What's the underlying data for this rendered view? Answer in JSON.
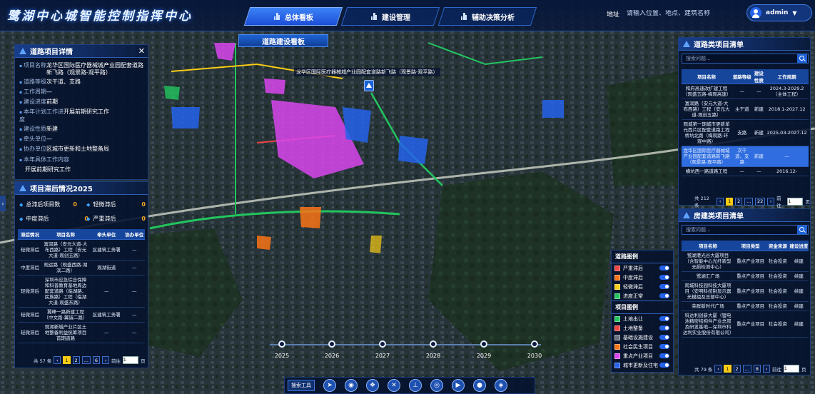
{
  "app": {
    "title": "鹭湖中心城智能控制指挥中心"
  },
  "nav": {
    "tabs": [
      {
        "label": "总体看板",
        "active": true
      },
      {
        "label": "建设管理",
        "active": false
      },
      {
        "label": "辅助决策分析",
        "active": false
      }
    ]
  },
  "search": {
    "label": "地址",
    "placeholder": "请输入位置、地点、建筑名称"
  },
  "user": {
    "name": "admin"
  },
  "board": {
    "title": "道路建设看板"
  },
  "map": {
    "label": "龙华区国际医疗器械城产业园配套道路新飞路（观景路-观平路）",
    "icon": "project-pin-icon"
  },
  "detail": {
    "title": "道路项目详情",
    "rows": [
      {
        "k": "项目名称",
        "v": "龙华区国际医疗器械城产业园配套道路新飞路（观景路-观平路）"
      },
      {
        "k": "道路等级",
        "v": "次干道、支路"
      },
      {
        "k": "工作周期",
        "v": "—"
      },
      {
        "k": "建设进度",
        "v": "前期"
      },
      {
        "k": "本年计划工作进度",
        "v": "开展前期研究工作"
      },
      {
        "k": "建设性质",
        "v": "新建"
      },
      {
        "k": "牵头单位",
        "v": "—"
      },
      {
        "k": "协办单位",
        "v": "区城市更新和土地整备局"
      }
    ],
    "content_label": "本年具体工作内容",
    "content_value": "开展前期研究工作"
  },
  "lag": {
    "title": "项目滞后情况2025",
    "stats": [
      {
        "label": "总滞后项目数",
        "value": "0"
      },
      {
        "label": "轻微滞后",
        "value": "0"
      },
      {
        "label": "中度滞后",
        "value": "0"
      },
      {
        "label": "严重滞后",
        "value": "0"
      }
    ],
    "headers": [
      "滞后情况",
      "项目名称",
      "牵头单位",
      "协办单位"
    ],
    "rows": [
      [
        "轻微滞后",
        "富润路（安元大道-大布西路）工程（安元大道-观创五路）",
        "区建筑工务署",
        "—"
      ],
      [
        "中度滞后",
        "观运路（观盛西路-湖滨二路）",
        "观湖街道",
        "—"
      ],
      [
        "轻微滞后",
        "深圳市应急综合保障和科普教育基地周边配套道路（临湖路、民族路）工程（临湖大道-观盛东路）",
        "—",
        "—"
      ],
      [
        "轻微滞后",
        "翼峰一路新建工程（中文路-翼诚二路）",
        "区建筑工务署",
        "—"
      ],
      [
        "轻微滞后",
        "观湖新城产业片区土地整备利益统筹项目首期道路",
        "—",
        "—"
      ]
    ],
    "pager": {
      "total": "共 57 条",
      "pages": [
        "1",
        "2",
        "...",
        "6"
      ],
      "current": "1",
      "goto_label": "前往",
      "goto_value": "1",
      "unit": "页"
    }
  },
  "road_list": {
    "title": "道路类项目清单",
    "search_placeholder": "搜索问题...",
    "headers": [
      "项目名称",
      "道路等级",
      "建设性质",
      "工作周期"
    ],
    "rows": [
      [
        "和府高速改扩建工程（观盛五路-梅观高速）",
        "—",
        "—",
        "2024.3-2029.2（主体工程）"
      ],
      [
        "富润路（安元大道-大布西路）工程（安元大道-观创五路）",
        "主干道",
        "新建",
        "2018.1-2027.12"
      ],
      [
        "观城第一期城市更新单元西片区配套道路工程桥坑北路（梅观路-环观中路）",
        "支路",
        "新建",
        "2025.03-2027.12"
      ],
      [
        "龙华区国际医疗器械城产业园配套道路新飞路（观景路-观平路）",
        "次干道、支路",
        "新建",
        "—"
      ],
      [
        "横坑西一路道路工程",
        "—",
        "—",
        "2016.12-"
      ]
    ],
    "selected_index": 3,
    "pager": {
      "total": "共 212 条",
      "pages": [
        "1",
        "2",
        "...",
        "22"
      ],
      "current": "1",
      "goto_label": "前往",
      "goto_value": "1",
      "unit": "页"
    }
  },
  "building_list": {
    "title": "房建类项目清单",
    "search_placeholder": "搜索问题...",
    "headers": [
      "项目名称",
      "项目类型",
      "资金来源",
      "建设进度"
    ],
    "rows": [
      [
        "鹭湖港光谷大厦项目（含智能中心光纤新型无损检测中心）",
        "重点产业项目",
        "社会投资",
        "续建"
      ],
      [
        "鹭湖汇广场",
        "重点产业项目",
        "社会投资",
        "续建"
      ],
      [
        "观城科技园科技大厦项目（安明科技制显示器光模组及总部中心）",
        "重点产业项目",
        "社会投资",
        "续建"
      ],
      [
        "荣群新时代广场",
        "重点产业项目",
        "社会投资",
        "续建"
      ],
      [
        "科达利创新大厦（锂电池精密结构件产业总部及研发基地—深圳市科达利实业股份有限公司）",
        "重点产业项目",
        "社会投资",
        "续建"
      ]
    ],
    "pager": {
      "total": "共 79 条",
      "pages": [
        "1",
        "2",
        "...",
        "8"
      ],
      "current": "1",
      "goto_label": "前往",
      "goto_value": "1",
      "unit": "页"
    }
  },
  "legend": {
    "road_title": "道路图例",
    "road_items": [
      {
        "label": "严重滞后",
        "color": "#ef4444"
      },
      {
        "label": "中度滞后",
        "color": "#f97316"
      },
      {
        "label": "轻微滞后",
        "color": "#facc15"
      },
      {
        "label": "进度正常",
        "color": "#22c55e"
      }
    ],
    "project_title": "项目图例",
    "project_items": [
      {
        "label": "土地出让",
        "color": "#22c55e"
      },
      {
        "label": "土地整备",
        "color": "#ef4444"
      },
      {
        "label": "基础设施建设",
        "color": "#6b7280"
      },
      {
        "label": "社会民生项目",
        "color": "#f97316"
      },
      {
        "label": "重点产业项目",
        "color": "#d946ef"
      },
      {
        "label": "城市更新及住宅",
        "color": "#2563eb"
      }
    ]
  },
  "timeline": {
    "years": [
      "2025",
      "2026",
      "2027",
      "2028",
      "2029",
      "2030"
    ]
  },
  "toolbar": {
    "search_label": "搜索工具",
    "buttons": [
      "navigate-icon",
      "location-pin-icon",
      "layers-icon",
      "close-tool-icon",
      "measure-icon",
      "eye-icon",
      "play-icon",
      "globe-icon",
      "cube-icon"
    ]
  }
}
